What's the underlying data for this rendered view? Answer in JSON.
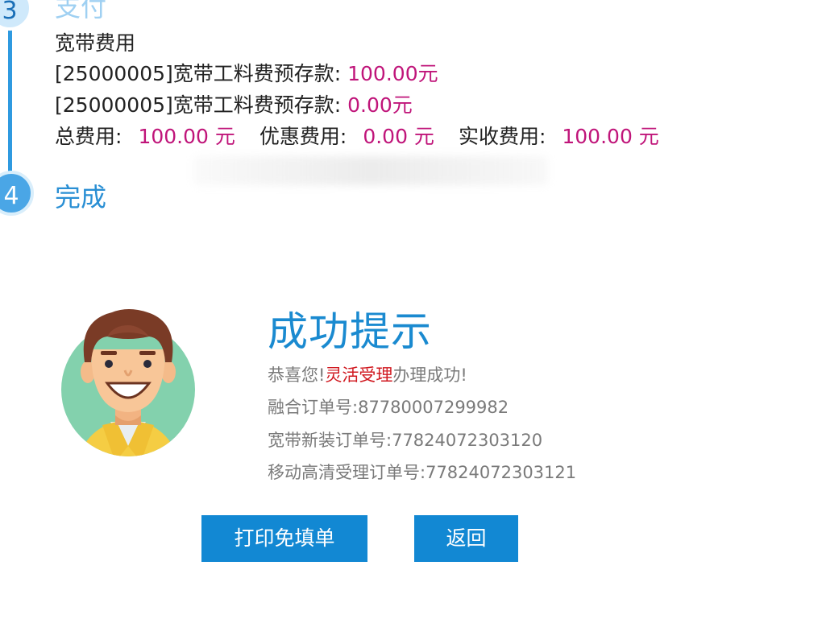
{
  "steps": {
    "step3": {
      "number": "3",
      "title": "支付"
    },
    "step4": {
      "number": "4",
      "title": "完成"
    }
  },
  "fees": {
    "section_title": "宽带费用",
    "items": [
      {
        "label": "[25000005]宽带工料费预存款: ",
        "amount": "100.00元"
      },
      {
        "label": "[25000005]宽带工料费预存款: ",
        "amount": "0.00元"
      }
    ],
    "summary": {
      "total_label": "总费用:",
      "total_value": "100.00 元",
      "discount_label": "优惠费用:",
      "discount_value": "0.00 元",
      "received_label": "实收费用:",
      "received_value": "100.00 元"
    }
  },
  "success": {
    "title": "成功提示",
    "congrats_prefix": "恭喜您!",
    "congrats_highlight": "灵活受理",
    "congrats_suffix": "办理成功!",
    "fusion_order_label": "融合订单号:",
    "fusion_order_value": "87780007299982",
    "broadband_order_label": "宽带新装订单号:",
    "broadband_order_value": "77824072303120",
    "mobile_tv_order_label": "移动高清受理订单号:",
    "mobile_tv_order_value": "77824072303121"
  },
  "buttons": {
    "print_label": "打印免填单",
    "back_label": "返回"
  },
  "colors": {
    "accent_blue": "#1288d3",
    "money_magenta": "#c0157a",
    "highlight_red": "#d0181f"
  }
}
